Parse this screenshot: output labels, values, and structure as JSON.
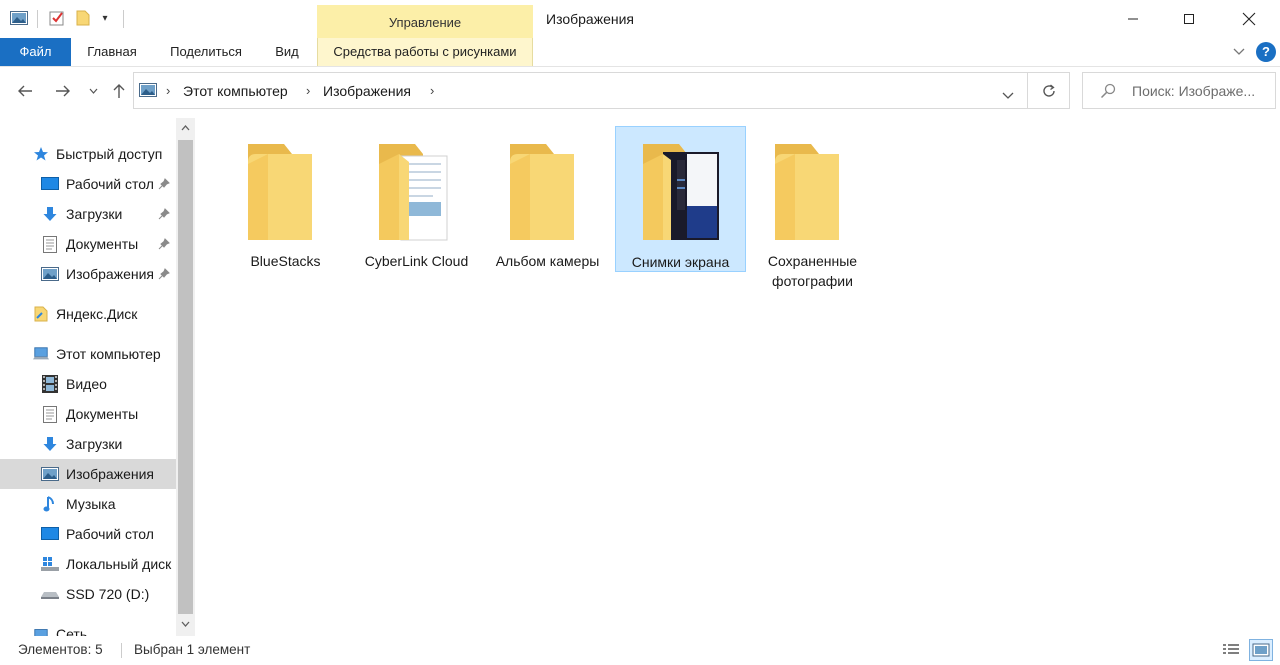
{
  "window": {
    "title": "Изображения",
    "manage_tab": "Управление"
  },
  "ribbon": {
    "tabs": [
      "Файл",
      "Главная",
      "Поделиться",
      "Вид",
      "Средства работы с рисунками"
    ]
  },
  "address": {
    "crumbs": [
      "Этот компьютер",
      "Изображения"
    ],
    "search_placeholder": "Поиск: Изображе..."
  },
  "nav": {
    "items": [
      {
        "label": "Быстрый доступ",
        "icon": "star-icon",
        "pinned": false
      },
      {
        "label": "Рабочий стол",
        "icon": "desktop-icon",
        "pinned": true
      },
      {
        "label": "Загрузки",
        "icon": "download-icon",
        "pinned": true
      },
      {
        "label": "Документы",
        "icon": "documents-icon",
        "pinned": true
      },
      {
        "label": "Изображения",
        "icon": "pictures-icon",
        "pinned": true
      },
      {
        "label": "Яндекс.Диск",
        "icon": "yandex-disk-icon",
        "pinned": false
      },
      {
        "label": "Этот компьютер",
        "icon": "computer-icon",
        "pinned": false
      },
      {
        "label": "Видео",
        "icon": "video-icon",
        "pinned": false
      },
      {
        "label": "Документы",
        "icon": "documents-icon",
        "pinned": false
      },
      {
        "label": "Загрузки",
        "icon": "download-icon",
        "pinned": false
      },
      {
        "label": "Изображения",
        "icon": "pictures-icon",
        "pinned": false,
        "selected": true
      },
      {
        "label": "Музыка",
        "icon": "music-icon",
        "pinned": false
      },
      {
        "label": "Рабочий стол",
        "icon": "desktop-icon",
        "pinned": false
      },
      {
        "label": "Локальный диск",
        "icon": "local-disk-icon",
        "pinned": false
      },
      {
        "label": "SSD 720 (D:)",
        "icon": "drive-icon",
        "pinned": false
      },
      {
        "label": "Сеть",
        "icon": "network-icon",
        "pinned": false
      }
    ]
  },
  "folders": [
    {
      "label": "BlueStacks",
      "type": "plain"
    },
    {
      "label": "CyberLink Cloud",
      "type": "docs"
    },
    {
      "label": "Альбом камеры",
      "type": "plain"
    },
    {
      "label": "Снимки экрана",
      "type": "screens",
      "selected": true
    },
    {
      "label": "Сохраненные фотографии",
      "type": "plain"
    }
  ],
  "status": {
    "count": "Элементов: 5",
    "selected": "Выбран 1 элемент"
  },
  "colors": {
    "file_tab": "#1a6fc3",
    "manage_tab": "#fcefa8",
    "selection": "#cce8ff",
    "folder": "#f8d775"
  }
}
